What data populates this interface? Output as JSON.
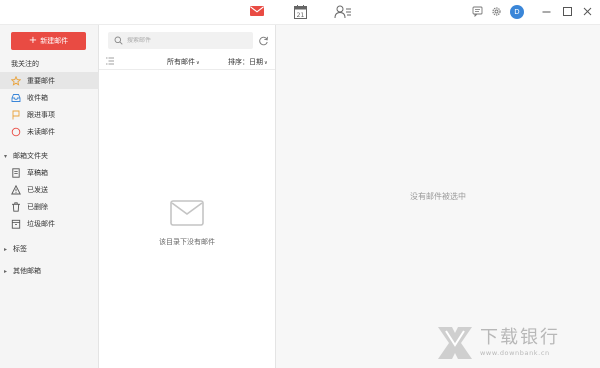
{
  "topbar": {
    "tabs": [
      {
        "name": "mail-tab",
        "icon": "envelope-icon",
        "active": true
      },
      {
        "name": "calendar-tab",
        "icon": "calendar-icon",
        "day": "21"
      },
      {
        "name": "contacts-tab",
        "icon": "contacts-icon"
      }
    ],
    "avatar_letter": "D",
    "accent_color": "#e94b43"
  },
  "sidebar": {
    "new_mail_label": "新建邮件",
    "focus_title": "我关注的",
    "focus_items": [
      {
        "label": "重要邮件",
        "icon": "star-icon",
        "active": true
      },
      {
        "label": "收件箱",
        "icon": "inbox-icon"
      },
      {
        "label": "跟进事项",
        "icon": "flag-icon"
      },
      {
        "label": "未读邮件",
        "icon": "unread-circle-icon"
      }
    ],
    "folders_title": "邮箱文件夹",
    "folder_items": [
      {
        "label": "草稿箱",
        "icon": "draft-icon"
      },
      {
        "label": "已发送",
        "icon": "sent-icon"
      },
      {
        "label": "已删除",
        "icon": "trash-icon"
      },
      {
        "label": "垃圾邮件",
        "icon": "spam-icon"
      }
    ],
    "tags_title": "标签",
    "other_title": "其他邮箱"
  },
  "list": {
    "search_placeholder": "搜索邮件",
    "filter_label": "所有邮件",
    "sort_prefix": "排序：",
    "sort_value": "日期",
    "empty_text": "该目录下没有邮件"
  },
  "reader": {
    "empty_text": "没有邮件被选中"
  },
  "watermark": {
    "cn": "下载银行",
    "en": "www.downbank.cn"
  }
}
